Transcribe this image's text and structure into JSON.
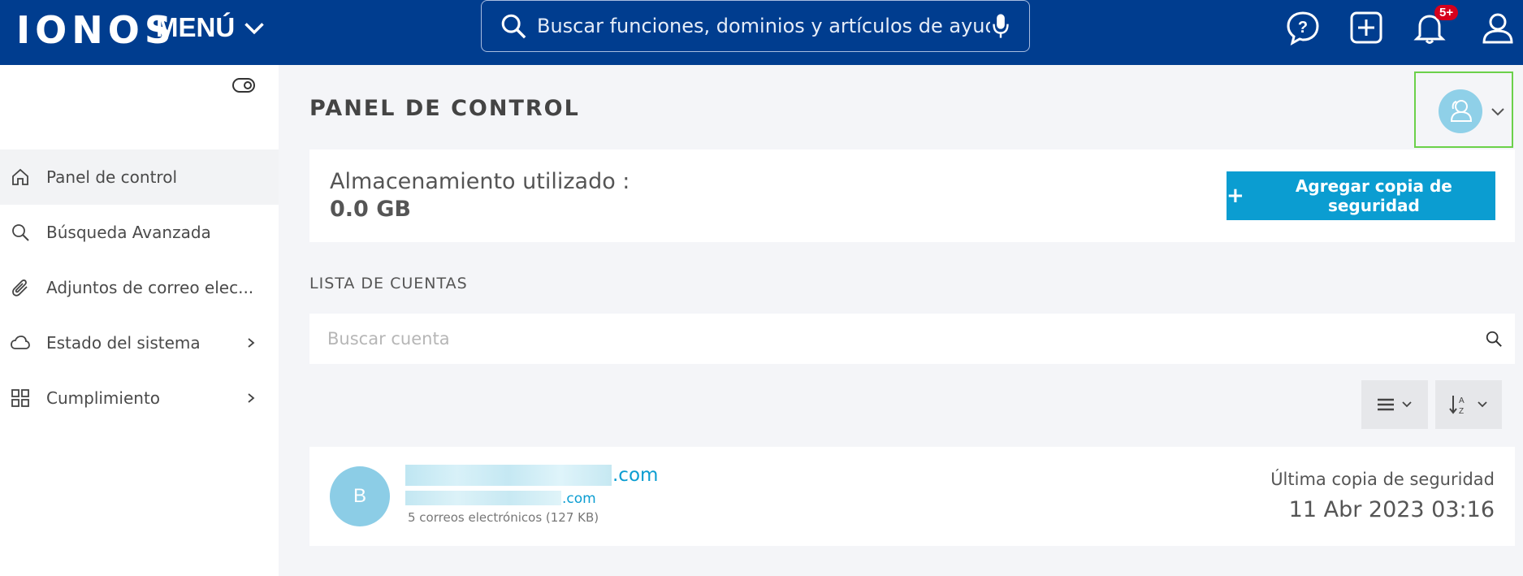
{
  "topbar": {
    "logo": "IONOS",
    "menu_label": "MENÚ",
    "search_placeholder": "Buscar funciones, dominios y artículos de ayuda",
    "notification_badge": "5+",
    "icons": [
      "help-icon",
      "add-icon",
      "bell-icon",
      "user-icon"
    ],
    "background_color": "#003d8f"
  },
  "sidebar": {
    "items": [
      {
        "label": "Panel de control",
        "icon": "home-icon",
        "active": true
      },
      {
        "label": "Búsqueda Avanzada",
        "icon": "search-icon"
      },
      {
        "label": "Adjuntos de correo elec...",
        "icon": "paperclip-icon"
      },
      {
        "label": "Estado del sistema",
        "icon": "cloud-icon",
        "has_submenu": true
      },
      {
        "label": "Cumplimiento",
        "icon": "grid-icon",
        "has_submenu": true
      }
    ]
  },
  "main": {
    "title": "PANEL DE CONTROL",
    "storage": {
      "label": "Almacenamiento utilizado :",
      "value": "0.0 GB",
      "add_button": "Agregar copia de seguridad"
    },
    "accounts_title": "LISTA DE CUENTAS",
    "search_placeholder": "Buscar cuenta",
    "accounts": [
      {
        "avatar_letter": "B",
        "domain_suffix": ".com",
        "alias_suffix": ".com",
        "info": "5 correos electrónicos (127 KB)",
        "last_backup_label": "Última copia de seguridad",
        "last_backup_value": "11 Abr 2023 03:16"
      }
    ]
  },
  "colors": {
    "accent": "#0b9dd1",
    "avatar": "#8ccde6",
    "highlight_border": "#6bd14a",
    "badge": "#d6001c"
  }
}
